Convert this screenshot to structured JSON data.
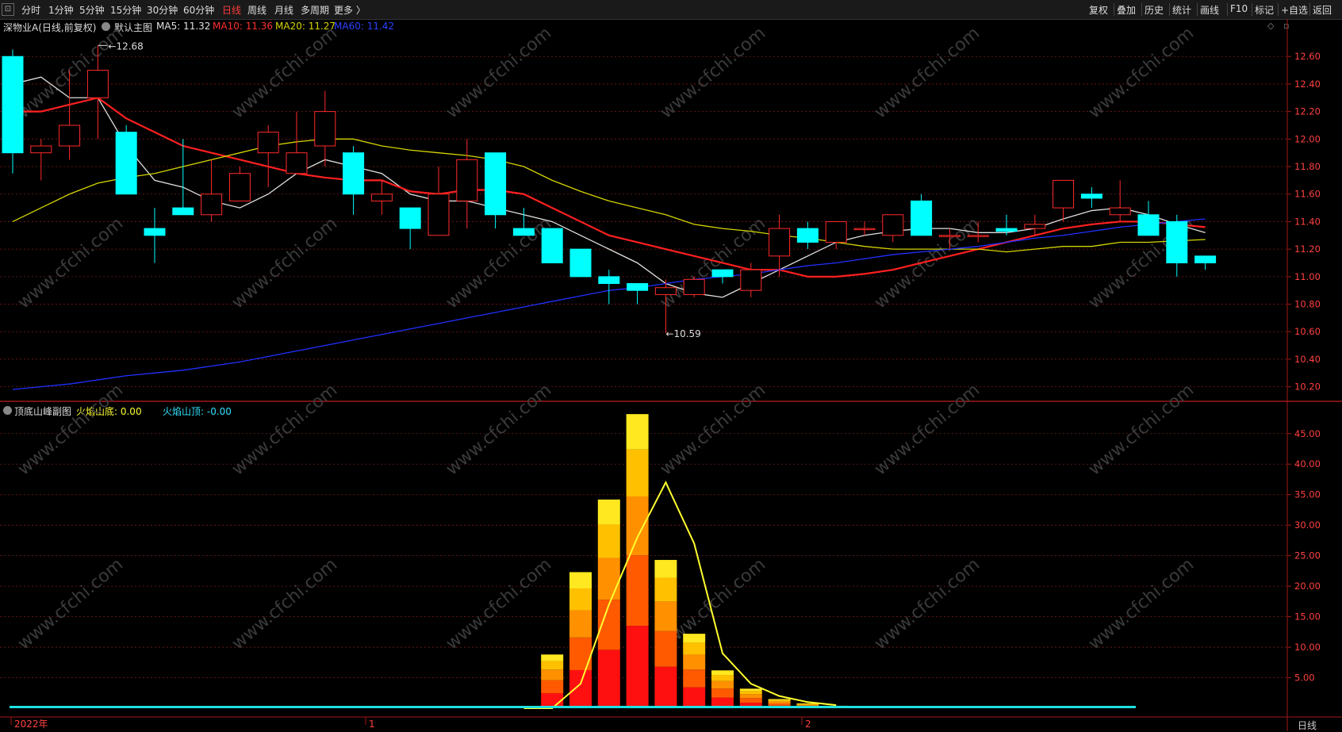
{
  "toolbar": {
    "periods": [
      "分时",
      "1分钟",
      "5分钟",
      "15分钟",
      "30分钟",
      "60分钟",
      "日线",
      "周线",
      "月线",
      "多周期",
      "更多 〉"
    ],
    "active_period": "日线",
    "tools": [
      "复权",
      "叠加",
      "历史",
      "统计",
      "画线",
      "F10",
      "标记",
      "+自选",
      "返回"
    ]
  },
  "main_legend": {
    "stock": "深物业A(日线,前复权)",
    "template": "默认主图",
    "ma5": "MA5: 11.32",
    "ma10": "MA10: 11.36",
    "ma20": "MA20: 11.27",
    "ma60": "MA60: 11.42"
  },
  "sub_legend": {
    "name": "顶底山峰副图",
    "bottom": "火焰山底: 0.00",
    "top": "火焰山顶: -0.00"
  },
  "annotations": {
    "high": "12.68",
    "low": "10.59"
  },
  "x_axis": {
    "label_year": "2022年",
    "label_1": "1",
    "label_2": "2"
  },
  "period_indicator": "日线",
  "watermark": "www.cfchi.com",
  "colors": {
    "up": "#ff2a2a",
    "down": "#00ffff",
    "ma5": "#e0e0e0",
    "ma10": "#ff2020",
    "ma20": "#d4d400",
    "ma60": "#2030ff",
    "grid": "#7a1a1a",
    "axis_text": "#ff4040",
    "flame_line": "#ffff30"
  },
  "chart_data": [
    {
      "type": "candlestick",
      "title": "深物业A(日线,前复权)",
      "y_ticks": [
        10.2,
        10.4,
        10.6,
        10.8,
        11.0,
        11.2,
        11.4,
        11.6,
        11.8,
        12.0,
        12.2,
        12.4,
        12.6
      ],
      "ylim": [
        10.1,
        12.78
      ],
      "candles": [
        [
          12.6,
          11.9,
          12.65,
          11.75
        ],
        [
          11.9,
          11.95,
          12.0,
          11.7
        ],
        [
          11.95,
          12.1,
          12.5,
          11.85
        ],
        [
          12.3,
          12.5,
          12.68,
          12.0
        ],
        [
          12.05,
          11.6,
          12.1,
          11.6
        ],
        [
          11.35,
          11.3,
          11.5,
          11.1
        ],
        [
          11.5,
          11.45,
          12.0,
          11.45
        ],
        [
          11.45,
          11.6,
          11.85,
          11.4
        ],
        [
          11.55,
          11.75,
          11.8,
          11.55
        ],
        [
          11.9,
          12.05,
          12.1,
          11.65
        ],
        [
          11.75,
          11.9,
          12.2,
          11.75
        ],
        [
          11.95,
          12.2,
          12.35,
          11.8
        ],
        [
          11.9,
          11.6,
          11.95,
          11.45
        ],
        [
          11.55,
          11.6,
          11.7,
          11.45
        ],
        [
          11.5,
          11.35,
          11.5,
          11.2
        ],
        [
          11.3,
          11.6,
          11.8,
          11.3
        ],
        [
          11.55,
          11.85,
          12.0,
          11.35
        ],
        [
          11.9,
          11.45,
          11.9,
          11.35
        ],
        [
          11.35,
          11.3,
          11.5,
          11.3
        ],
        [
          11.35,
          11.1,
          11.35,
          11.1
        ],
        [
          11.2,
          11.0,
          11.2,
          11.0
        ],
        [
          11.0,
          10.95,
          11.05,
          10.8
        ],
        [
          10.95,
          10.9,
          10.95,
          10.8
        ],
        [
          10.87,
          10.92,
          10.98,
          10.59
        ],
        [
          10.87,
          10.98,
          11.0,
          10.85
        ],
        [
          11.05,
          11.0,
          11.05,
          10.95
        ],
        [
          10.9,
          11.05,
          11.1,
          10.85
        ],
        [
          11.15,
          11.35,
          11.45,
          11.0
        ],
        [
          11.35,
          11.25,
          11.4,
          11.2
        ],
        [
          11.25,
          11.4,
          11.4,
          11.2
        ],
        [
          11.35,
          11.35,
          11.4,
          11.3
        ],
        [
          11.3,
          11.45,
          11.45,
          11.25
        ],
        [
          11.55,
          11.3,
          11.6,
          11.3
        ],
        [
          11.3,
          11.3,
          11.35,
          11.2
        ],
        [
          11.3,
          11.3,
          11.4,
          11.25
        ],
        [
          11.35,
          11.33,
          11.45,
          11.3
        ],
        [
          11.35,
          11.38,
          11.45,
          11.3
        ],
        [
          11.5,
          11.7,
          11.7,
          11.4
        ],
        [
          11.6,
          11.57,
          11.65,
          11.5
        ],
        [
          11.45,
          11.5,
          11.7,
          11.4
        ],
        [
          11.45,
          11.3,
          11.55,
          11.3
        ],
        [
          11.4,
          11.1,
          11.45,
          11.0
        ],
        [
          11.15,
          11.1,
          11.15,
          11.05
        ]
      ],
      "series": [
        {
          "name": "MA5",
          "values": [
            12.4,
            12.45,
            12.3,
            12.3,
            11.95,
            11.7,
            11.65,
            11.55,
            11.5,
            11.6,
            11.75,
            11.85,
            11.8,
            11.75,
            11.6,
            11.55,
            11.55,
            11.5,
            11.45,
            11.4,
            11.3,
            11.2,
            11.1,
            10.95,
            10.88,
            10.85,
            10.95,
            11.05,
            11.15,
            11.25,
            11.3,
            11.33,
            11.35,
            11.35,
            11.32,
            11.32,
            11.35,
            11.42,
            11.48,
            11.5,
            11.45,
            11.38,
            11.32
          ]
        },
        {
          "name": "MA10",
          "values": [
            12.2,
            12.2,
            12.25,
            12.3,
            12.15,
            12.05,
            11.95,
            11.9,
            11.85,
            11.8,
            11.75,
            11.72,
            11.7,
            11.7,
            11.62,
            11.6,
            11.63,
            11.63,
            11.6,
            11.5,
            11.4,
            11.3,
            11.25,
            11.2,
            11.15,
            11.1,
            11.05,
            11.05,
            11.0,
            11.0,
            11.02,
            11.05,
            11.1,
            11.15,
            11.2,
            11.25,
            11.3,
            11.35,
            11.38,
            11.4,
            11.4,
            11.38,
            11.36
          ]
        },
        {
          "name": "MA20",
          "values": [
            11.4,
            11.5,
            11.6,
            11.68,
            11.72,
            11.75,
            11.8,
            11.85,
            11.9,
            11.95,
            11.98,
            12.0,
            12.0,
            11.95,
            11.92,
            11.9,
            11.88,
            11.85,
            11.8,
            11.7,
            11.62,
            11.55,
            11.5,
            11.45,
            11.38,
            11.35,
            11.33,
            11.3,
            11.28,
            11.25,
            11.22,
            11.2,
            11.2,
            11.2,
            11.2,
            11.18,
            11.2,
            11.22,
            11.22,
            11.25,
            11.25,
            11.26,
            11.27
          ]
        },
        {
          "name": "MA60",
          "values": [
            10.18,
            10.2,
            10.22,
            10.25,
            10.28,
            10.3,
            10.32,
            10.35,
            10.38,
            10.42,
            10.46,
            10.5,
            10.54,
            10.58,
            10.62,
            10.66,
            10.7,
            10.74,
            10.78,
            10.82,
            10.86,
            10.9,
            10.92,
            10.95,
            10.98,
            11.0,
            11.02,
            11.05,
            11.08,
            11.1,
            11.13,
            11.16,
            11.18,
            11.2,
            11.22,
            11.25,
            11.28,
            11.3,
            11.33,
            11.36,
            11.38,
            11.4,
            11.42
          ]
        }
      ]
    },
    {
      "type": "bar",
      "title": "顶底山峰副图",
      "y_ticks": [
        5,
        10,
        15,
        20,
        25,
        30,
        35,
        40,
        45
      ],
      "ylim": [
        0,
        49
      ],
      "categories_index": [
        19,
        20,
        21,
        22,
        23,
        24,
        25,
        26,
        27,
        28,
        29
      ],
      "values": [
        8.8,
        22.3,
        34.2,
        48.2,
        24.3,
        12.2,
        6.2,
        3.2,
        1.5,
        0.8,
        0.4
      ],
      "flame_line": [
        0,
        4,
        17,
        28,
        37,
        27,
        9,
        4,
        2,
        1,
        0.5
      ]
    }
  ]
}
